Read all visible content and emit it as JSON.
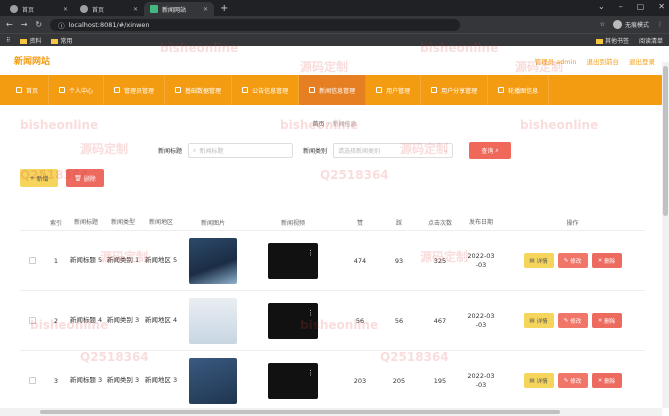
{
  "browser": {
    "tabs": [
      {
        "label": "首页"
      },
      {
        "label": "首页"
      },
      {
        "label": "新闻网站",
        "active": true
      }
    ],
    "url": "localhost:8081/#/xinwen",
    "incognito": "无痕模式",
    "bookmarks": [
      "资料",
      "常用"
    ],
    "bookmarks_right": [
      "其他书签",
      "阅读清单"
    ]
  },
  "header": {
    "logo": "新闻网站",
    "user_link": "管理员 admin",
    "back_link": "退出到前台",
    "logout_link": "退出登录",
    "accent_color": "#f39c12"
  },
  "nav": [
    {
      "label": "首页",
      "icon": "home-icon"
    },
    {
      "label": "个人中心",
      "icon": "user-icon"
    },
    {
      "label": "管理员管理",
      "icon": "admin-icon"
    },
    {
      "label": "基础数据管理",
      "icon": "data-icon"
    },
    {
      "label": "公告信息管理",
      "icon": "notice-icon"
    },
    {
      "label": "新闻信息管理",
      "icon": "news-icon",
      "active": true
    },
    {
      "label": "用户管理",
      "icon": "users-icon"
    },
    {
      "label": "用户分享管理",
      "icon": "share-icon"
    },
    {
      "label": "轮播图信息",
      "icon": "carousel-icon"
    }
  ],
  "breadcrumb": {
    "home": "首页",
    "current": "新闻信息"
  },
  "search": {
    "title_label": "新闻标题",
    "title_placeholder": "新闻标题",
    "type_label": "新闻类别",
    "type_placeholder": "请选择新闻类别",
    "query_button": "查询"
  },
  "actions": {
    "add": "新增",
    "delete": "删除"
  },
  "table": {
    "headers": [
      "索引",
      "新闻标题",
      "新闻类型",
      "新闻地区",
      "新闻图片",
      "新闻视频",
      "赞",
      "踩",
      "点击次数",
      "发布日期",
      "操作"
    ],
    "rows": [
      {
        "index": "1",
        "title": "新闻标题 5",
        "type": "新闻类别 1",
        "area": "新闻地区 5",
        "zan": "474",
        "cai": "93",
        "clicks": "325",
        "date": "2022-03 -03"
      },
      {
        "index": "2",
        "title": "新闻标题 4",
        "type": "新闻类别 3",
        "area": "新闻地区 4",
        "zan": "56",
        "cai": "56",
        "clicks": "467",
        "date": "2022-03 -03"
      },
      {
        "index": "3",
        "title": "新闻标题 3",
        "type": "新闻类别 3",
        "area": "新闻地区 3",
        "zan": "203",
        "cai": "205",
        "clicks": "195",
        "date": "2022-03 -03"
      }
    ],
    "ops": {
      "detail": "详情",
      "edit": "修改",
      "delete": "删除"
    }
  },
  "watermark": {
    "site": "bisheonline",
    "cn": "源码定制",
    "num": "Q2518364"
  }
}
